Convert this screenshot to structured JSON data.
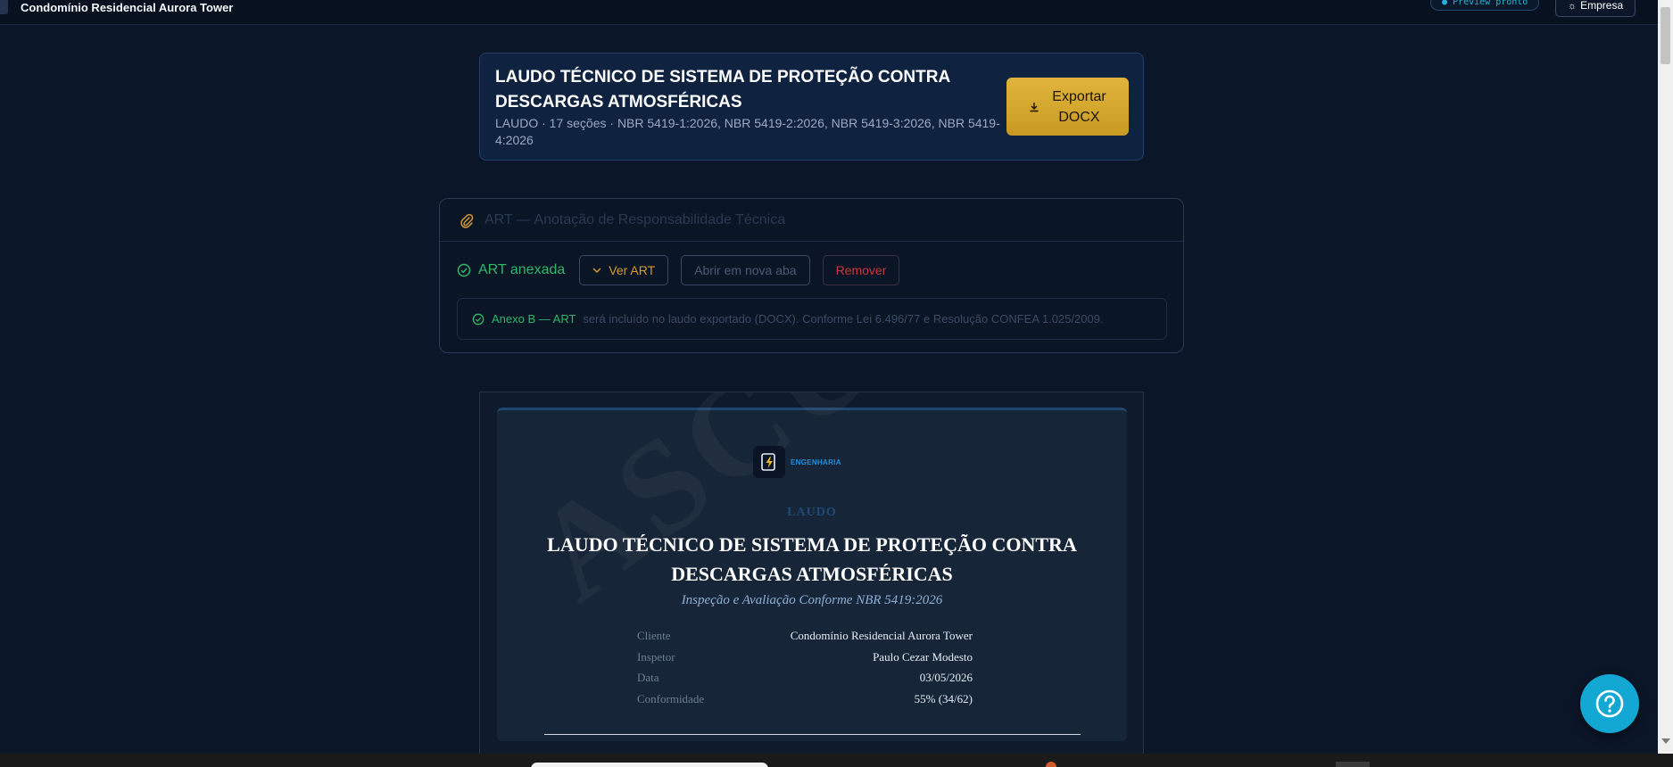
{
  "topbar": {
    "project_title": "Condomínio Residencial Aurora Tower",
    "preview_label": "● Preview pronto",
    "empresa_label": "Empresa"
  },
  "header": {
    "title": "LAUDO TÉCNICO DE SISTEMA DE PROTEÇÃO CONTRA DESCARGAS ATMOSFÉRICAS",
    "meta": "LAUDO · 17 seções · NBR 5419-1:2026, NBR 5419-2:2026, NBR 5419-3:2026, NBR 5419-4:2026",
    "export_label_1": "Exportar",
    "export_label_2": "DOCX"
  },
  "art": {
    "section_title": "ART — Anotação de Responsabilidade Técnica",
    "status": "ART anexada",
    "view_btn": "Ver ART",
    "open_btn": "Abrir em nova aba",
    "remove_btn": "Remover",
    "annex_lead": "Anexo B — ART",
    "annex_rest": "será incluído no laudo exportado (DOCX). Conforme Lei 6.496/77 e Resolução CONFEA 1.025/2009."
  },
  "document": {
    "logo_brand": "ENGENHARIA",
    "type": "LAUDO",
    "title": "LAUDO TÉCNICO DE SISTEMA DE PROTEÇÃO CONTRA DESCARGAS ATMOSFÉRICAS",
    "subtitle": "Inspeção e Avaliação Conforme NBR 5419:2026",
    "watermark": "ASCUNHO",
    "info": [
      {
        "label": "Cliente",
        "value": "Condomínio Residencial Aurora Tower"
      },
      {
        "label": "Inspetor",
        "value": "Paulo Cezar Modesto"
      },
      {
        "label": "Data",
        "value": "03/05/2026"
      },
      {
        "label": "Conformidade",
        "value": "55% (34/62)"
      }
    ]
  },
  "colors": {
    "background": "#0b1628",
    "accent_gold": "#d9ab30",
    "success": "#2fb76a",
    "danger": "#c23b3b",
    "help": "#12a8d3"
  },
  "icons": {
    "settings": "gear-icon",
    "download": "download-icon",
    "attachment": "paperclip-icon",
    "check": "check-circle-icon",
    "chevron": "chevron-down-icon",
    "help": "question-icon"
  }
}
